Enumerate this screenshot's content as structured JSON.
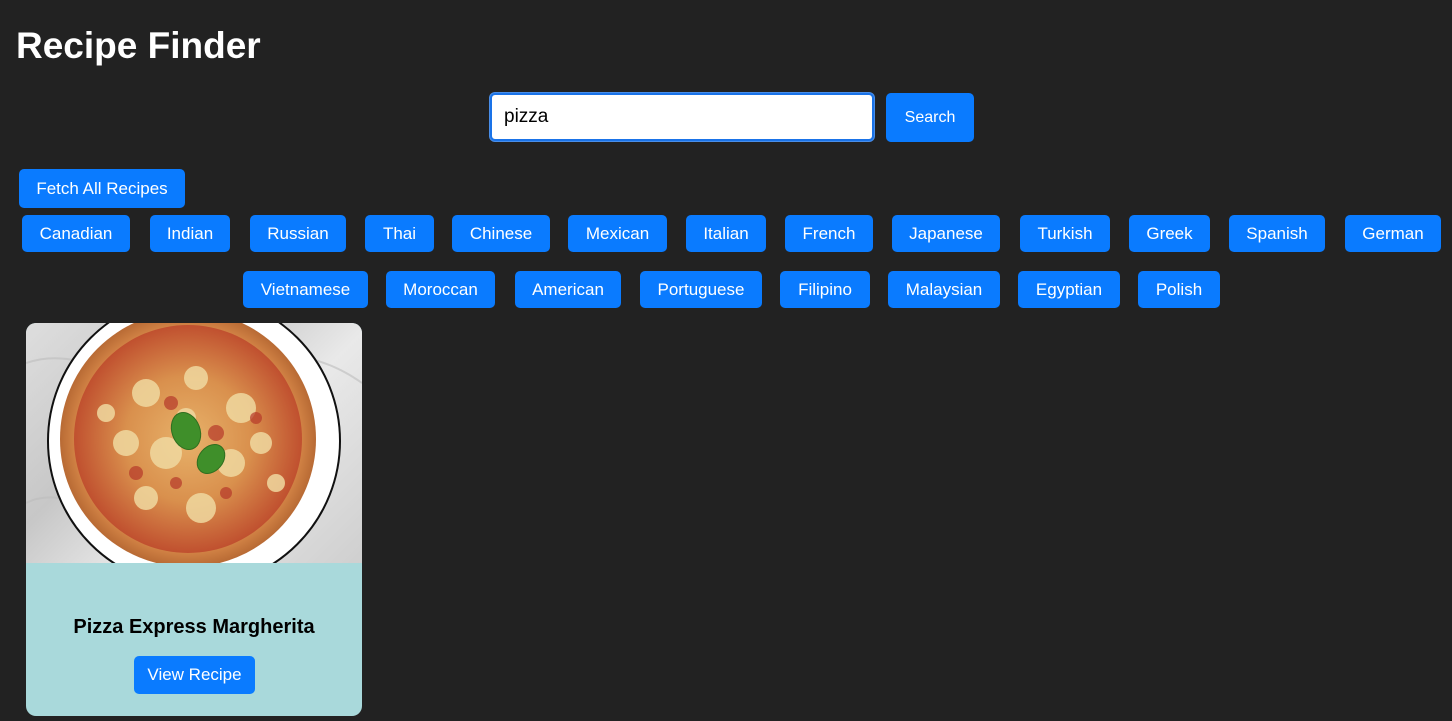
{
  "app": {
    "title": "Recipe Finder"
  },
  "search": {
    "value": "pizza",
    "button_label": "Search"
  },
  "fetch_all_label": "Fetch All Recipes",
  "areas_row1": [
    "Canadian",
    "Indian",
    "Russian",
    "Thai",
    "Chinese",
    "Mexican",
    "Italian",
    "French",
    "Japanese",
    "Turkish",
    "Greek",
    "Spanish",
    "German"
  ],
  "areas_row2": [
    "Vietnamese",
    "Moroccan",
    "American",
    "Portuguese",
    "Filipino",
    "Malaysian",
    "Egyptian",
    "Polish"
  ],
  "recipes": [
    {
      "name": "Pizza Express Margherita",
      "button_label": "View Recipe",
      "image_icon": "pizza-image"
    }
  ],
  "colors": {
    "background": "#222222",
    "accent": "#0a7bff",
    "card": "#a9d9db"
  }
}
